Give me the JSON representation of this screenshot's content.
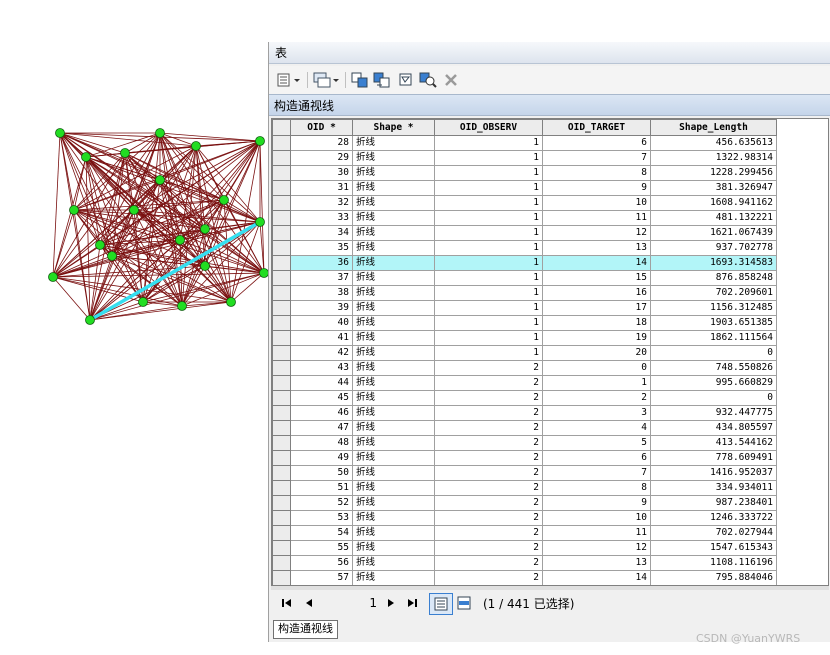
{
  "window": {
    "title": "表"
  },
  "table_tab": {
    "label": "构造通视线"
  },
  "bottom_tab": {
    "label": "构造通视线"
  },
  "columns": [
    "OID *",
    "Shape *",
    "OID_OBSERV",
    "OID_TARGET",
    "Shape_Length"
  ],
  "rows": [
    [
      "28",
      "折线",
      "1",
      "6",
      "456.635613"
    ],
    [
      "29",
      "折线",
      "1",
      "7",
      "1322.98314"
    ],
    [
      "30",
      "折线",
      "1",
      "8",
      "1228.299456"
    ],
    [
      "31",
      "折线",
      "1",
      "9",
      "381.326947"
    ],
    [
      "32",
      "折线",
      "1",
      "10",
      "1608.941162"
    ],
    [
      "33",
      "折线",
      "1",
      "11",
      "481.132221"
    ],
    [
      "34",
      "折线",
      "1",
      "12",
      "1621.067439"
    ],
    [
      "35",
      "折线",
      "1",
      "13",
      "937.702778"
    ],
    [
      "36",
      "折线",
      "1",
      "14",
      "1693.314583"
    ],
    [
      "37",
      "折线",
      "1",
      "15",
      "876.858248"
    ],
    [
      "38",
      "折线",
      "1",
      "16",
      "702.209601"
    ],
    [
      "39",
      "折线",
      "1",
      "17",
      "1156.312485"
    ],
    [
      "40",
      "折线",
      "1",
      "18",
      "1903.651385"
    ],
    [
      "41",
      "折线",
      "1",
      "19",
      "1862.111564"
    ],
    [
      "42",
      "折线",
      "1",
      "20",
      "0"
    ],
    [
      "43",
      "折线",
      "2",
      "0",
      "748.550826"
    ],
    [
      "44",
      "折线",
      "2",
      "1",
      "995.660829"
    ],
    [
      "45",
      "折线",
      "2",
      "2",
      "0"
    ],
    [
      "46",
      "折线",
      "2",
      "3",
      "932.447775"
    ],
    [
      "47",
      "折线",
      "2",
      "4",
      "434.805597"
    ],
    [
      "48",
      "折线",
      "2",
      "5",
      "413.544162"
    ],
    [
      "49",
      "折线",
      "2",
      "6",
      "778.609491"
    ],
    [
      "50",
      "折线",
      "2",
      "7",
      "1416.952037"
    ],
    [
      "51",
      "折线",
      "2",
      "8",
      "334.934011"
    ],
    [
      "52",
      "折线",
      "2",
      "9",
      "987.238401"
    ],
    [
      "53",
      "折线",
      "2",
      "10",
      "1246.333722"
    ],
    [
      "54",
      "折线",
      "2",
      "11",
      "702.027944"
    ],
    [
      "55",
      "折线",
      "2",
      "12",
      "1547.615343"
    ],
    [
      "56",
      "折线",
      "2",
      "13",
      "1108.116196"
    ],
    [
      "57",
      "折线",
      "2",
      "14",
      "795.884046"
    ]
  ],
  "highlighted_oid": "36",
  "navigation": {
    "current_record": "1",
    "selection_status": "(1 / 441 已选择)"
  },
  "watermark": "CSDN @YuanYWRS",
  "map": {
    "line_color": "#7a1010",
    "node_color": "#22dd22",
    "selected_line_color": "#35dff0"
  },
  "toolbar_icons": [
    "table-options-icon",
    "related-tables-icon",
    "select-by-attributes-icon",
    "switch-selection-icon",
    "clear-selection-icon",
    "zoom-to-selected-icon",
    "delete-selected-icon"
  ]
}
